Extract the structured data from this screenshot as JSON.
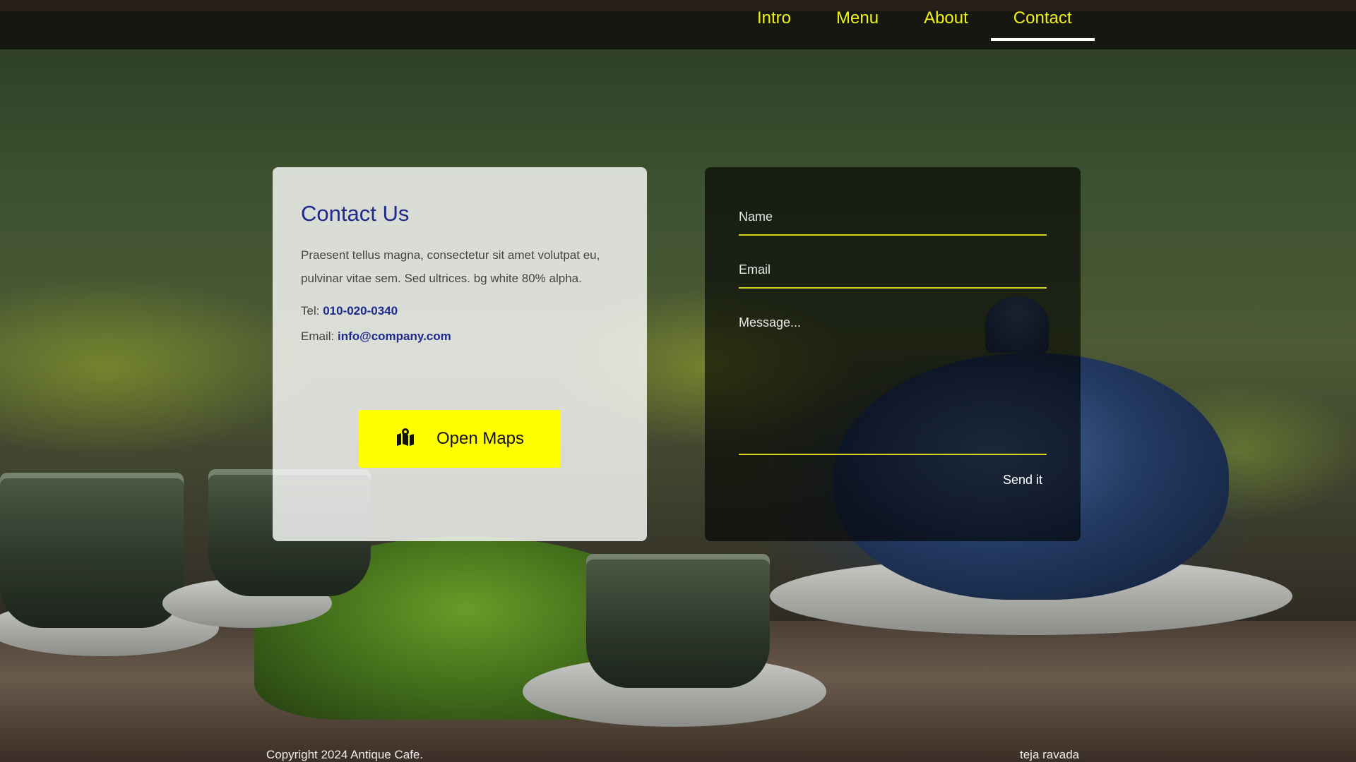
{
  "nav": {
    "items": [
      {
        "label": "Intro"
      },
      {
        "label": "Menu"
      },
      {
        "label": "About"
      },
      {
        "label": "Contact"
      }
    ],
    "active": "Contact"
  },
  "contact": {
    "title": "Contact Us",
    "description": "Praesent tellus magna, consectetur sit amet volutpat eu, pulvinar vitae sem. Sed ultrices. bg white 80% alpha.",
    "tel_label": "Tel:",
    "tel_value": "010-020-0340",
    "email_label": "Email:",
    "email_value": "info@company.com",
    "maps_button": "Open Maps",
    "maps_icon": "map-marked-icon"
  },
  "form": {
    "name_placeholder": "Name",
    "email_placeholder": "Email",
    "message_placeholder": "Message...",
    "send_label": "Send it"
  },
  "footer": {
    "copyright": "Copyright 2024 Antique Cafe.",
    "author": "teja ravada"
  },
  "colors": {
    "accent": "#ffff00",
    "nav_text": "#f2f213",
    "title_blue": "#1d2a8c",
    "field_underline": "#d4d41a"
  }
}
